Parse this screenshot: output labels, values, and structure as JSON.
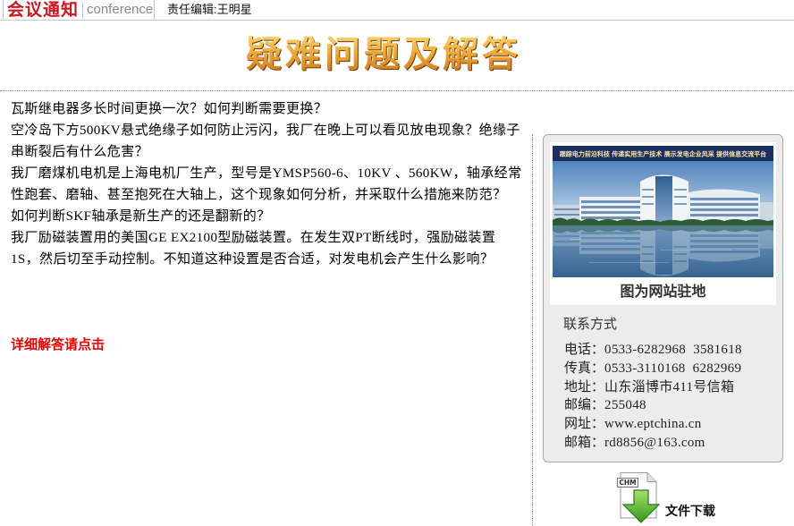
{
  "header": {
    "logo_cn": "会议通知",
    "logo_en": "conference",
    "editor": "责任编辑:王明星"
  },
  "title": "疑难问题及解答",
  "questions": [
    "瓦斯继电器多长时间更换一次？如何判断需要更换？",
    "空冷岛下方500KV悬式绝缘子如何防止污闪，我厂在晚上可以看见放电现象？绝缘子串断裂后有什么危害？",
    "我厂磨煤机电机是上海电机厂生产，型号是YMSP560-6、10KV 、560KW，轴承经常性跑套、磨轴、甚至抱死在大轴上，这个现象如何分析，并采取什么措施来防范？",
    "如何判断SKF轴承是新生产的还是翻新的？",
    "我厂励磁装置用的美国GE EX2100型励磁装置。在发生双PT断线时，强励磁装置1S，然后切至手动控制。不知道这种设置是否合适，对发电机会产生什么影响？"
  ],
  "detail_link": "详细解答请点击",
  "sidebar": {
    "photo_banner": "跟踪电力前沿科技 传递实用生产技术 展示发电企业风采 提供信息交流平台",
    "photo_caption": "图为网站驻地",
    "contact_heading": "联系方式",
    "contacts": [
      {
        "label": "电话：",
        "value": "0533-6282968  3581618"
      },
      {
        "label": "传真：",
        "value": "0533-3110168  6282969"
      },
      {
        "label": "地址：",
        "value": "山东淄博市411号信箱"
      },
      {
        "label": "邮编：",
        "value": "255048"
      },
      {
        "label": "网址：",
        "value": "www.eptchina.cn"
      },
      {
        "label": "邮箱：",
        "value": "rd8856@163.com"
      }
    ]
  },
  "download": {
    "icon": "chm-download-icon",
    "file_type": "CHM",
    "label": "文件下载"
  },
  "colors": {
    "logo_red": "#d0161c",
    "link_red": "#f00000",
    "panel_gray": "#ececec"
  }
}
